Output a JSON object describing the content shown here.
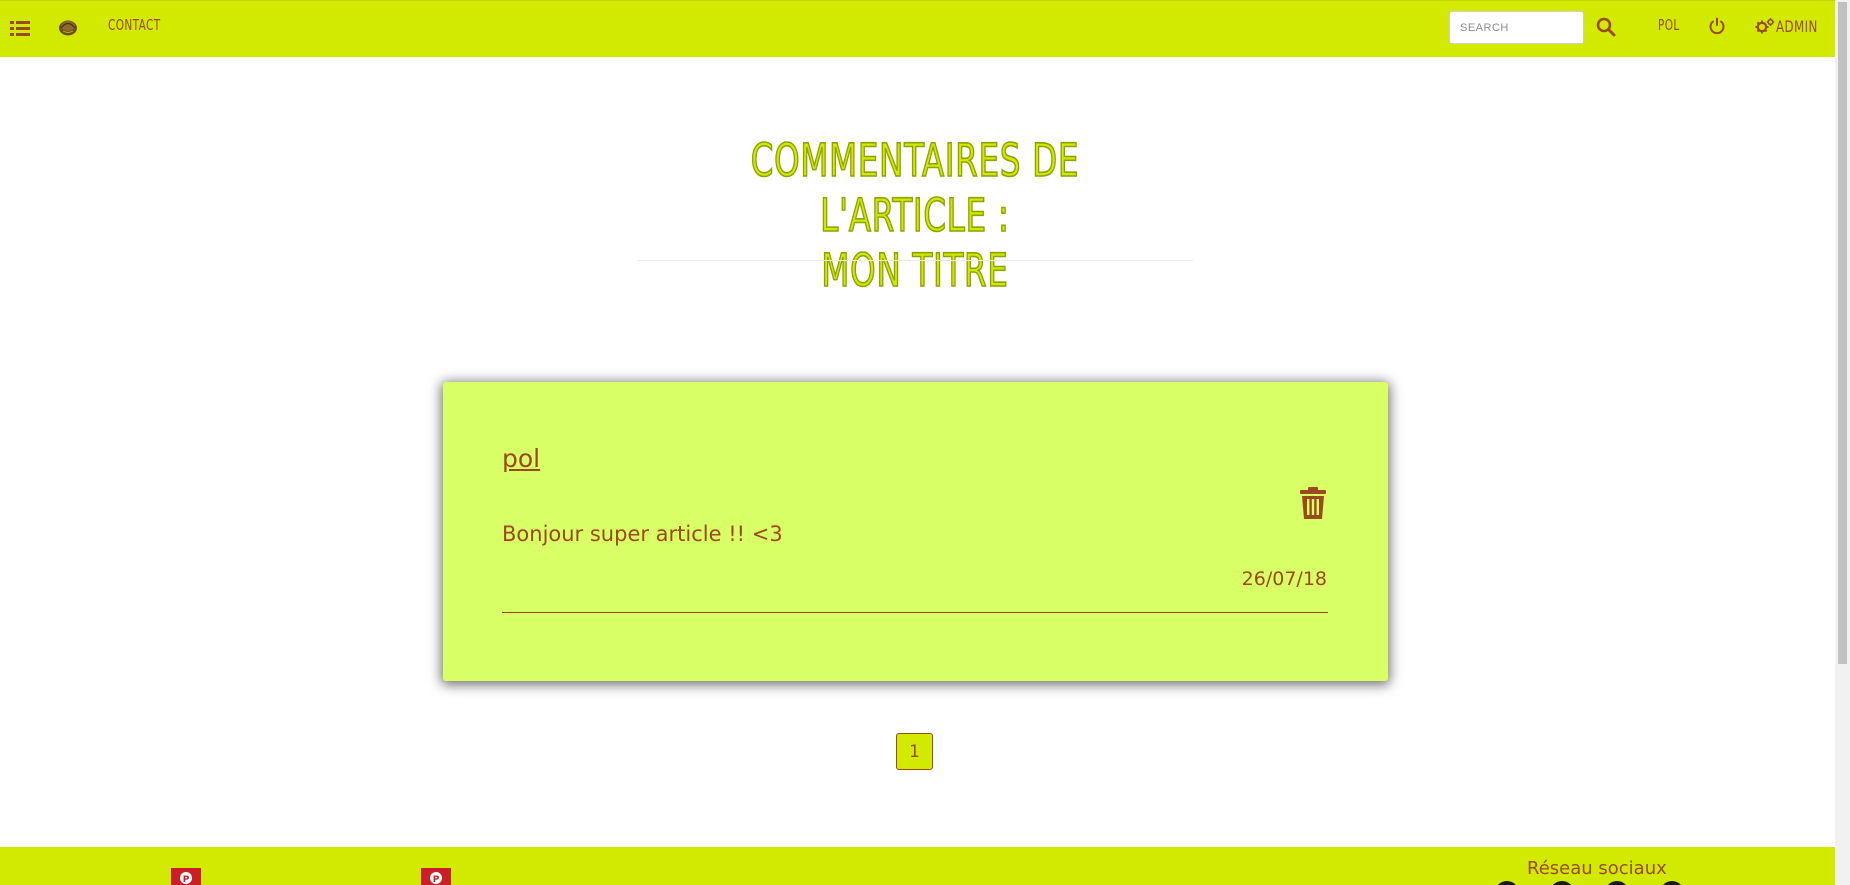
{
  "navbar": {
    "menu_icon": "list-icon",
    "logo_icon": "chestnut-logo-icon",
    "contact_label": "Contact",
    "search_placeholder": "SEARCH",
    "search_value": "",
    "search_icon": "search-icon",
    "user_label": "POL",
    "power_icon": "power-icon",
    "admin_icon": "cogs-icon",
    "admin_label": "Admin"
  },
  "page": {
    "title_line1": "Commentaires de l'article :",
    "title_line2": "Mon titre"
  },
  "comment": {
    "author": "pol",
    "text": "Bonjour super article !! <3",
    "date": "26/07/18",
    "delete_icon": "trash-icon"
  },
  "pagination": {
    "current_page": "1"
  },
  "footer": {
    "social_heading": "Réseau sociaux",
    "pinterest_icon": "pinterest-icon"
  },
  "colors": {
    "accent": "#d1ea00",
    "card": "#d8ff66",
    "text": "#9a4a1c",
    "pinterest": "#cb1f27"
  }
}
